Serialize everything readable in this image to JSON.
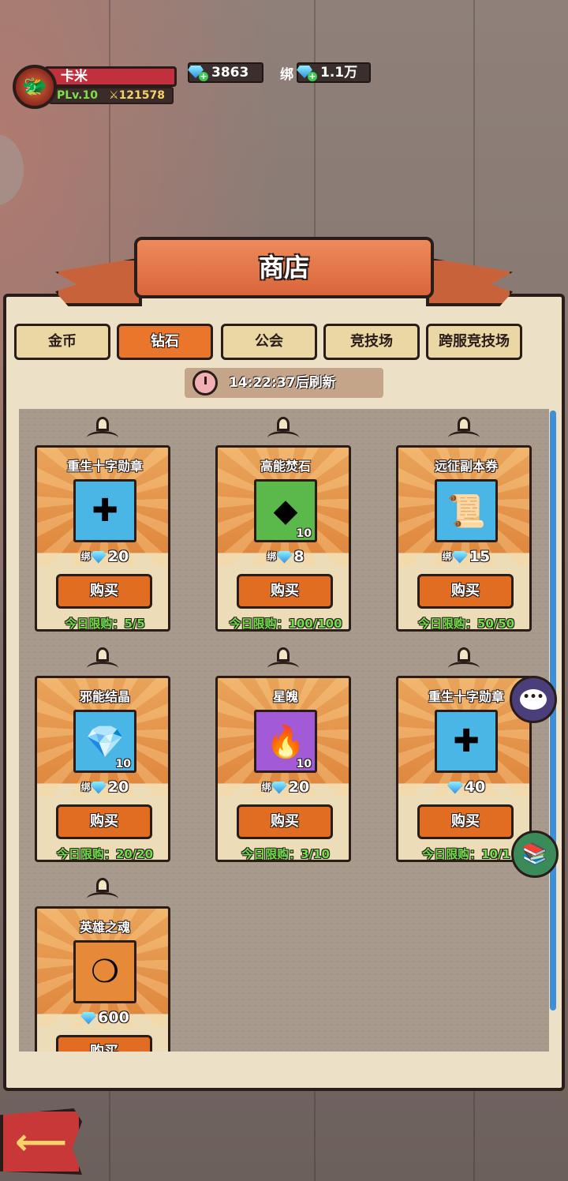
{
  "player": {
    "name": "卡米",
    "level": "PLv.10",
    "power": "121578"
  },
  "currency": {
    "diamond": "3863",
    "bound_prefix": "绑",
    "bound_diamond": "1.1万"
  },
  "shop": {
    "title": "商店",
    "tabs": [
      {
        "label": "金币",
        "active": false
      },
      {
        "label": "钻石",
        "active": true
      },
      {
        "label": "公会",
        "active": false
      },
      {
        "label": "竞技场",
        "active": false
      },
      {
        "label": "跨服竞技场",
        "active": false
      }
    ],
    "refresh": "14:22:37后刷新",
    "buy_label": "购买",
    "items": [
      {
        "name": "重生十字勋章",
        "icon": "cross-medal-icon",
        "qty": "",
        "bound": "绑",
        "price": "20",
        "limit": "今日限购：5/5",
        "color": "#4ab6e6"
      },
      {
        "name": "高能焚石",
        "icon": "fire-stone-icon",
        "qty": "10",
        "bound": "绑",
        "price": "8",
        "limit": "今日限购：100/100",
        "color": "#5bb84a"
      },
      {
        "name": "远征副本券",
        "icon": "ticket-icon",
        "qty": "",
        "bound": "绑",
        "price": "15",
        "limit": "今日限购：50/50",
        "color": "#4ab6e6"
      },
      {
        "name": "邪能结晶",
        "icon": "crystal-icon",
        "qty": "10",
        "bound": "绑",
        "price": "20",
        "limit": "今日限购：20/20",
        "color": "#4ab6e6"
      },
      {
        "name": "星魄",
        "icon": "star-soul-icon",
        "qty": "10",
        "bound": "绑",
        "price": "20",
        "limit": "今日限购：3/10",
        "color": "#a25ad6"
      },
      {
        "name": "重生十字勋章",
        "icon": "cross-medal-icon",
        "qty": "",
        "bound": "",
        "price": "40",
        "limit": "今日限购：10/1",
        "color": "#4ab6e6"
      },
      {
        "name": "英雄之魂",
        "icon": "hero-soul-icon",
        "qty": "",
        "bound": "",
        "price": "600",
        "limit": "",
        "color": "#e68a3a"
      }
    ]
  }
}
